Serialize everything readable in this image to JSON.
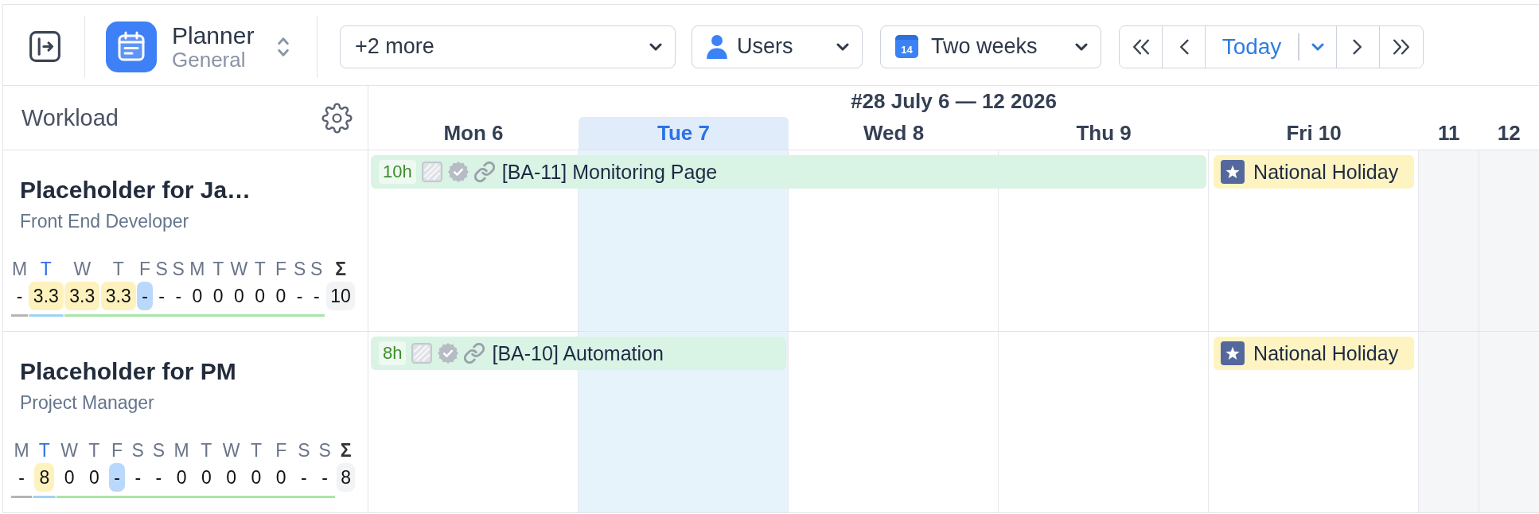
{
  "toolbar": {
    "project": {
      "name": "Planner",
      "subtitle": "General"
    },
    "filters": [
      {
        "kind": "filter",
        "label": "+2 more"
      },
      {
        "kind": "users",
        "label": "Users"
      },
      {
        "kind": "period",
        "label": "Two weeks",
        "icon_text": "14"
      }
    ],
    "today_button": "Today"
  },
  "panel_title": "Workload",
  "calendar": {
    "week_label": "#28 July 6 — 12 2026",
    "days": [
      {
        "label": "Mon 6",
        "today": false,
        "weekend": false
      },
      {
        "label": "Tue 7",
        "today": true,
        "weekend": false
      },
      {
        "label": "Wed 8",
        "today": false,
        "weekend": false
      },
      {
        "label": "Thu 9",
        "today": false,
        "weekend": false
      },
      {
        "label": "Fri 10",
        "today": false,
        "weekend": false
      },
      {
        "label": "11",
        "today": false,
        "weekend": true
      },
      {
        "label": "12",
        "today": false,
        "weekend": true
      }
    ]
  },
  "members": [
    {
      "name": "Placeholder for Ja…",
      "role": "Front End Developer",
      "days": [
        {
          "letter": "M",
          "value": "-",
          "kind": "plain",
          "past": true,
          "today": false
        },
        {
          "letter": "T",
          "value": "3.3",
          "kind": "hours",
          "past": false,
          "today": true
        },
        {
          "letter": "W",
          "value": "3.3",
          "kind": "hours",
          "past": false,
          "today": false
        },
        {
          "letter": "T",
          "value": "3.3",
          "kind": "hours",
          "past": false,
          "today": false
        },
        {
          "letter": "F",
          "value": "-",
          "kind": "holiday",
          "past": false,
          "today": false
        },
        {
          "letter": "S",
          "value": "-",
          "kind": "plain",
          "past": false,
          "today": false
        },
        {
          "letter": "S",
          "value": "-",
          "kind": "plain",
          "past": false,
          "today": false
        },
        {
          "letter": "M",
          "value": "0",
          "kind": "plain",
          "past": false,
          "today": false
        },
        {
          "letter": "T",
          "value": "0",
          "kind": "plain",
          "past": false,
          "today": false
        },
        {
          "letter": "W",
          "value": "0",
          "kind": "plain",
          "past": false,
          "today": false
        },
        {
          "letter": "T",
          "value": "0",
          "kind": "plain",
          "past": false,
          "today": false
        },
        {
          "letter": "F",
          "value": "0",
          "kind": "plain",
          "past": false,
          "today": false
        },
        {
          "letter": "S",
          "value": "-",
          "kind": "plain",
          "past": false,
          "today": false
        },
        {
          "letter": "S",
          "value": "-",
          "kind": "plain",
          "past": false,
          "today": false
        }
      ],
      "total_symbol": "Σ",
      "total": "10",
      "timeline": [
        {
          "kind": "task",
          "hours": "10h",
          "title": "[BA-11] Monitoring Page"
        },
        {
          "kind": "continued"
        },
        {
          "kind": "continued"
        },
        {
          "kind": "continued"
        },
        {
          "kind": "holiday",
          "title": "National Holiday"
        },
        {
          "kind": "empty"
        },
        {
          "kind": "empty"
        }
      ]
    },
    {
      "name": "Placeholder for PM",
      "role": "Project Manager",
      "days": [
        {
          "letter": "M",
          "value": "-",
          "kind": "plain",
          "past": true,
          "today": false
        },
        {
          "letter": "T",
          "value": "8",
          "kind": "hours",
          "past": false,
          "today": true
        },
        {
          "letter": "W",
          "value": "0",
          "kind": "plain",
          "past": false,
          "today": false
        },
        {
          "letter": "T",
          "value": "0",
          "kind": "plain",
          "past": false,
          "today": false
        },
        {
          "letter": "F",
          "value": "-",
          "kind": "holiday",
          "past": false,
          "today": false
        },
        {
          "letter": "S",
          "value": "-",
          "kind": "plain",
          "past": false,
          "today": false
        },
        {
          "letter": "S",
          "value": "-",
          "kind": "plain",
          "past": false,
          "today": false
        },
        {
          "letter": "M",
          "value": "0",
          "kind": "plain",
          "past": false,
          "today": false
        },
        {
          "letter": "T",
          "value": "0",
          "kind": "plain",
          "past": false,
          "today": false
        },
        {
          "letter": "W",
          "value": "0",
          "kind": "plain",
          "past": false,
          "today": false
        },
        {
          "letter": "T",
          "value": "0",
          "kind": "plain",
          "past": false,
          "today": false
        },
        {
          "letter": "F",
          "value": "0",
          "kind": "plain",
          "past": false,
          "today": false
        },
        {
          "letter": "S",
          "value": "-",
          "kind": "plain",
          "past": false,
          "today": false
        },
        {
          "letter": "S",
          "value": "-",
          "kind": "plain",
          "past": false,
          "today": false
        }
      ],
      "total_symbol": "Σ",
      "total": "8",
      "timeline": [
        {
          "kind": "task",
          "hours": "8h",
          "title": "[BA-10] Automation"
        },
        {
          "kind": "continued"
        },
        {
          "kind": "empty"
        },
        {
          "kind": "empty"
        },
        {
          "kind": "holiday",
          "title": "National Holiday"
        },
        {
          "kind": "empty"
        },
        {
          "kind": "empty"
        }
      ]
    }
  ]
}
